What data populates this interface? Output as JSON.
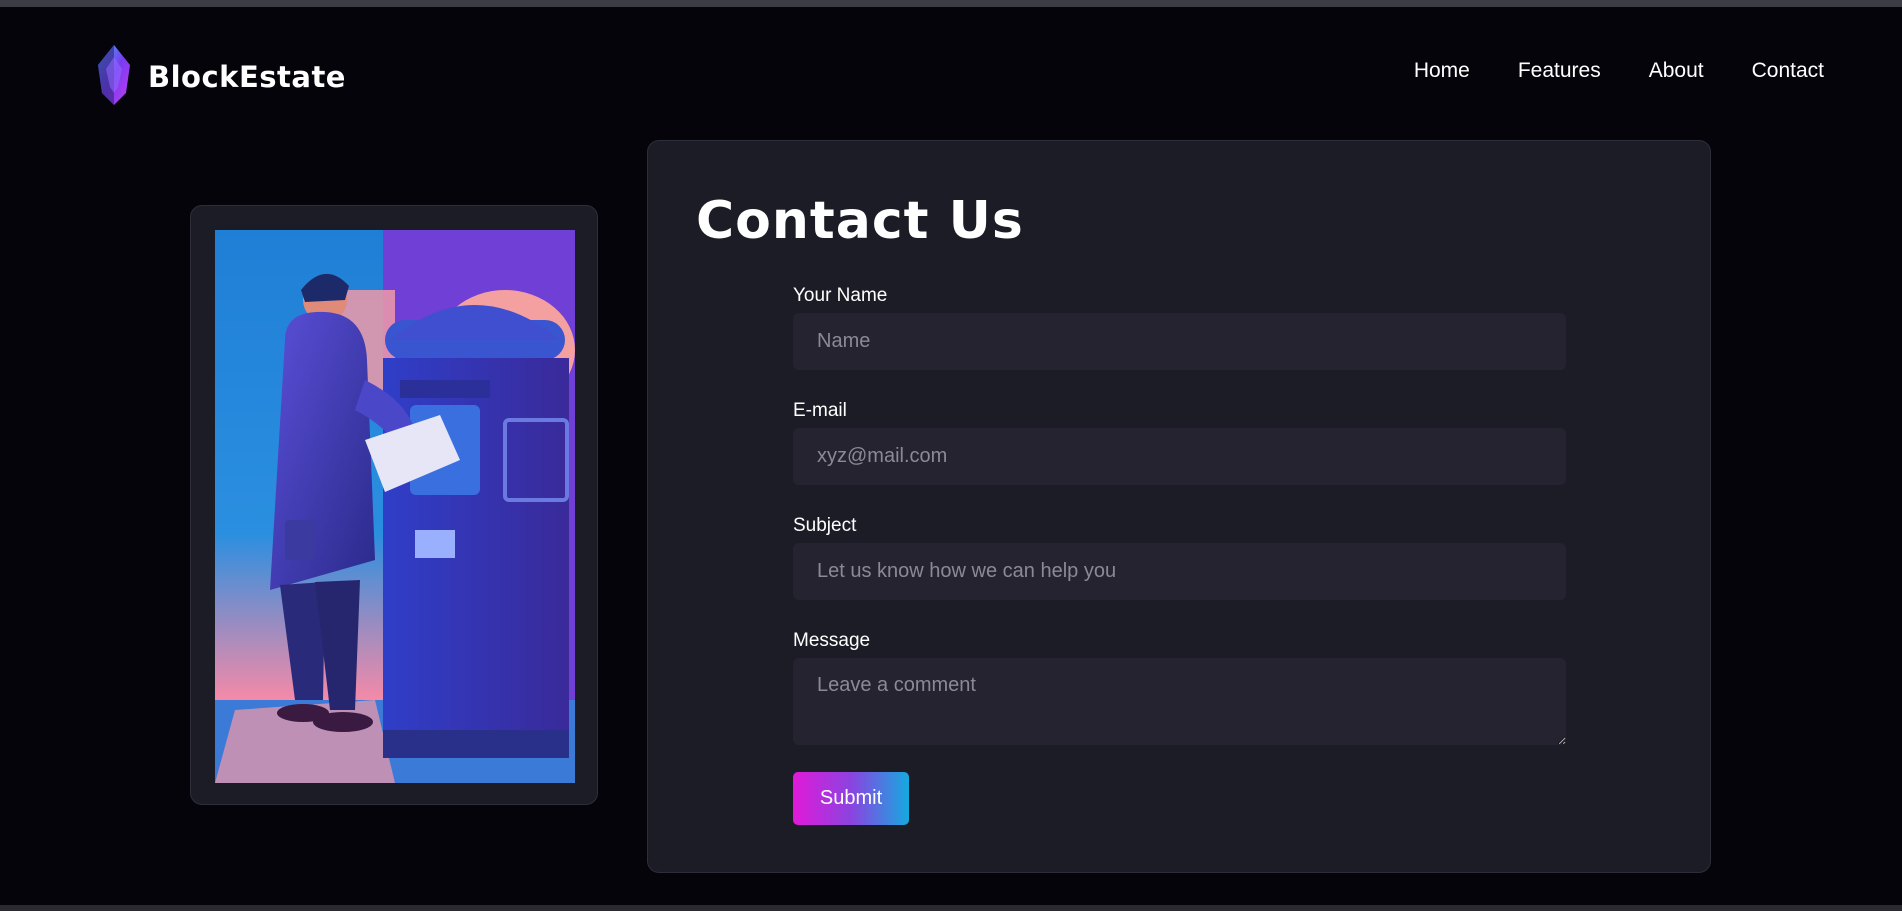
{
  "brand": {
    "name": "BlockEstate",
    "logo": "crystal-logo-icon"
  },
  "nav": {
    "items": [
      "Home",
      "Features",
      "About",
      "Contact"
    ]
  },
  "contact": {
    "title": "Contact Us",
    "fields": [
      {
        "label": "Your Name",
        "placeholder": "Name"
      },
      {
        "label": "E-mail",
        "placeholder": "xyz@mail.com"
      },
      {
        "label": "Subject",
        "placeholder": "Let us know how we can help you"
      },
      {
        "label": "Message",
        "placeholder": "Leave a comment"
      }
    ],
    "submit_label": "Submit"
  },
  "colors": {
    "background": "#04040a",
    "card": "#1c1c26",
    "input": "#25232f",
    "submit_gradient": [
      "#e11ad8",
      "#16a9e0"
    ]
  }
}
